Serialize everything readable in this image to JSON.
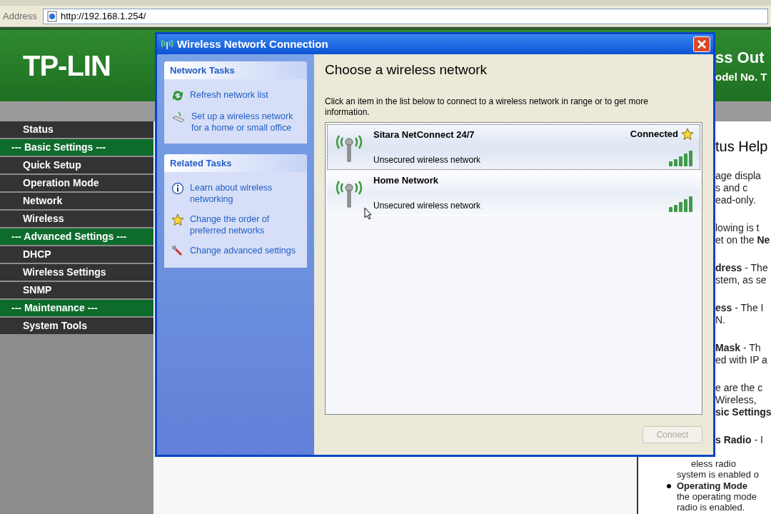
{
  "address_bar": {
    "label": "Address",
    "url": "http://192.168.1.254/"
  },
  "header": {
    "logo": "TP-LIN",
    "title_fragment": "ss Out",
    "model_fragment": "odel No. T"
  },
  "sidebar": {
    "items": [
      {
        "kind": "link",
        "label": "Status"
      },
      {
        "kind": "section",
        "label": "--- Basic Settings ---"
      },
      {
        "kind": "link",
        "label": "Quick Setup"
      },
      {
        "kind": "link",
        "label": "Operation Mode"
      },
      {
        "kind": "link",
        "label": "Network"
      },
      {
        "kind": "link",
        "label": "Wireless"
      },
      {
        "kind": "section",
        "label": "--- Advanced Settings ---"
      },
      {
        "kind": "link",
        "label": "DHCP"
      },
      {
        "kind": "link",
        "label": "Wireless Settings"
      },
      {
        "kind": "link",
        "label": "SNMP"
      },
      {
        "kind": "section",
        "label": "--- Maintenance ---"
      },
      {
        "kind": "link",
        "label": "System Tools"
      }
    ]
  },
  "help": {
    "heading": "tus Help",
    "paragraphs": [
      [
        "age displa",
        "s and c",
        "ead-only."
      ],
      [
        "lowing is t",
        "et on the **Ne**"
      ],
      [
        "**dress** - The",
        "stem, as se"
      ],
      [
        "**ess** - The I",
        "N."
      ],
      [
        "**Mask** - Th",
        "ed with IP a"
      ],
      [
        "e are the c",
        "Wireless,",
        "**sic Settings**"
      ],
      [
        "**s Radio** - I"
      ]
    ],
    "lower": [
      {
        "kind": "partial",
        "text": "eless radio"
      },
      {
        "kind": "text",
        "text": "system is enabled o"
      },
      {
        "kind": "bullet",
        "text": "Operating Mode"
      },
      {
        "kind": "text",
        "text": "the operating mode"
      },
      {
        "kind": "text",
        "text": "radio is enabled."
      }
    ]
  },
  "dialog": {
    "title": "Wireless Network Connection",
    "task_boxes": [
      {
        "title": "Network Tasks",
        "items": [
          {
            "kind": "refresh",
            "label": "Refresh network list"
          },
          {
            "kind": "setup",
            "label": "Set up a wireless network for a home or small office"
          }
        ]
      },
      {
        "title": "Related Tasks",
        "items": [
          {
            "kind": "info",
            "label": "Learn about wireless networking"
          },
          {
            "kind": "star",
            "label": "Change the order of preferred networks"
          },
          {
            "kind": "wrench",
            "label": "Change advanced settings"
          }
        ]
      }
    ],
    "heading": "Choose a wireless network",
    "instruction": "Click an item in the list below to connect to a wireless network in range or to get more information.",
    "networks": [
      {
        "name": "Sitara NetConnect 24/7",
        "status": "Connected",
        "preferred": true,
        "security": "Unsecured wireless network",
        "selected": true
      },
      {
        "name": "Home Network",
        "preferred": false,
        "security": "Unsecured wireless network",
        "selected": false
      }
    ],
    "connect_button": {
      "label": "Connect",
      "disabled": true
    }
  }
}
